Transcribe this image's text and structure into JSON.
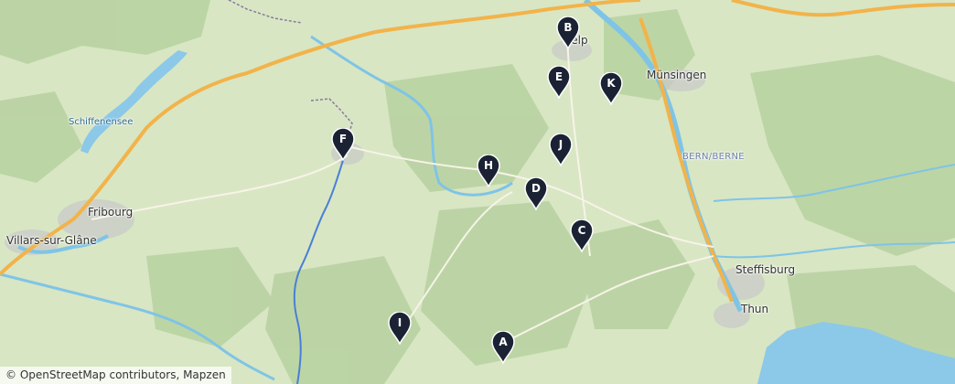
{
  "places": [
    {
      "id": "belp",
      "label": "Belp",
      "kind": "town"
    },
    {
      "id": "muensingen",
      "label": "Münsingen",
      "kind": "town"
    },
    {
      "id": "schiffenensee",
      "label": "Schiffenensee",
      "kind": "water"
    },
    {
      "id": "fribourg",
      "label": "Fribourg",
      "kind": "town"
    },
    {
      "id": "villars",
      "label": "Villars-sur-Glâne",
      "kind": "town"
    },
    {
      "id": "bern",
      "label": "BERN/BERNE",
      "kind": "region"
    },
    {
      "id": "steffisburg",
      "label": "Steffisburg",
      "kind": "town"
    },
    {
      "id": "thun",
      "label": "Thun",
      "kind": "town"
    }
  ],
  "markers": [
    {
      "letter": "A"
    },
    {
      "letter": "B"
    },
    {
      "letter": "C"
    },
    {
      "letter": "D"
    },
    {
      "letter": "E"
    },
    {
      "letter": "F"
    },
    {
      "letter": "H"
    },
    {
      "letter": "I"
    },
    {
      "letter": "J"
    },
    {
      "letter": "K"
    }
  ],
  "attribution": "© OpenStreetMap contributors, Mapzen",
  "colors": {
    "land": "#d8e6c4",
    "forest": "#b9d3a2",
    "water": "#7fc4e6",
    "lake": "#8cc8e8",
    "river": "#4a7fd6",
    "motorway": "#f2b34a",
    "road": "#f8f3e8",
    "border": "#8b7a9e",
    "urban": "#c9c9c9",
    "marker": "#1b2233"
  }
}
